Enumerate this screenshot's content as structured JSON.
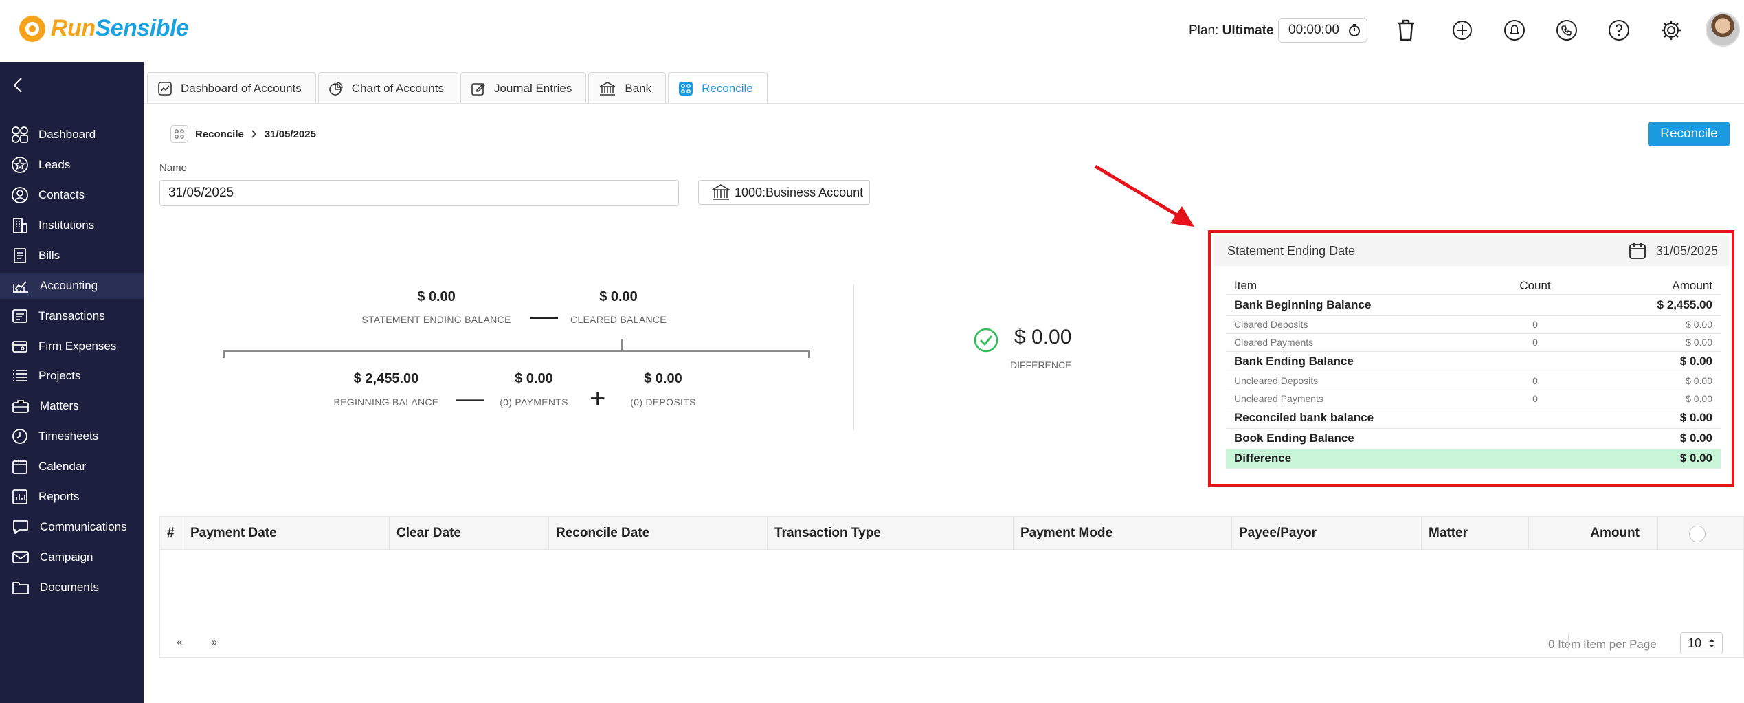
{
  "brand": {
    "run": "Run",
    "sensible": "Sensible"
  },
  "header": {
    "plan_label": "Plan:",
    "plan_value": "Ultimate",
    "timer": "00:00:00"
  },
  "sidebar": {
    "items": [
      {
        "label": "Dashboard"
      },
      {
        "label": "Leads"
      },
      {
        "label": "Contacts"
      },
      {
        "label": "Institutions"
      },
      {
        "label": "Bills"
      },
      {
        "label": "Accounting"
      },
      {
        "label": "Transactions"
      },
      {
        "label": "Firm Expenses"
      },
      {
        "label": "Projects"
      },
      {
        "label": "Matters"
      },
      {
        "label": "Timesheets"
      },
      {
        "label": "Calendar"
      },
      {
        "label": "Reports"
      },
      {
        "label": "Communications"
      },
      {
        "label": "Campaign"
      },
      {
        "label": "Documents"
      }
    ]
  },
  "tabs": [
    {
      "label": "Dashboard of Accounts"
    },
    {
      "label": "Chart of Accounts"
    },
    {
      "label": "Journal Entries"
    },
    {
      "label": "Bank"
    },
    {
      "label": "Reconcile"
    }
  ],
  "breadcrumb": {
    "root": "Reconcile",
    "current": "31/05/2025"
  },
  "actions": {
    "reconcile": "Reconcile"
  },
  "form": {
    "name_label": "Name",
    "name_value": "31/05/2025",
    "account": "1000:Business Account"
  },
  "calc": {
    "statement_ending_balance": "$ 0.00",
    "statement_ending_balance_label": "STATEMENT ENDING BALANCE",
    "cleared_balance": "$ 0.00",
    "cleared_balance_label": "CLEARED BALANCE",
    "beginning_balance": "$ 2,455.00",
    "beginning_balance_label": "BEGINNING BALANCE",
    "payments": "$ 0.00",
    "payments_label": "(0) PAYMENTS",
    "deposits": "$ 0.00",
    "deposits_label": "(0) DEPOSITS",
    "minus": "—",
    "plus": "+",
    "difference": "$ 0.00",
    "difference_label": "DIFFERENCE"
  },
  "summary": {
    "ending_date_label": "Statement Ending Date",
    "ending_date": "31/05/2025",
    "columns": {
      "item": "Item",
      "count": "Count",
      "amount": "Amount"
    },
    "rows": [
      {
        "item": "Bank Beginning Balance",
        "count": "",
        "amount": "$ 2,455.00"
      },
      {
        "item": "Cleared Deposits",
        "count": "0",
        "amount": "$ 0.00"
      },
      {
        "item": "Cleared Payments",
        "count": "0",
        "amount": "$ 0.00"
      },
      {
        "item": "Bank Ending Balance",
        "count": "",
        "amount": "$ 0.00"
      },
      {
        "item": "Uncleared Deposits",
        "count": "0",
        "amount": "$ 0.00"
      },
      {
        "item": "Uncleared Payments",
        "count": "0",
        "amount": "$ 0.00"
      },
      {
        "item": "Reconciled bank balance",
        "count": "",
        "amount": "$ 0.00"
      },
      {
        "item": "Book Ending Balance",
        "count": "",
        "amount": "$ 0.00"
      },
      {
        "item": "Difference",
        "count": "",
        "amount": "$ 0.00"
      }
    ]
  },
  "grid": {
    "columns": [
      "#",
      "Payment Date",
      "Clear Date",
      "Reconcile Date",
      "Transaction Type",
      "Payment Mode",
      "Payee/Payor",
      "Matter",
      "Amount"
    ],
    "pager_prev": "«",
    "pager_next": "»",
    "item_count": "0 Item",
    "per_page_label": "Item per Page",
    "per_page": "10"
  },
  "colors": {
    "accent": "#1a9be0",
    "sidebar": "#1c1f3d",
    "highlight": "#e5141a",
    "success": "#2fbf5a"
  }
}
